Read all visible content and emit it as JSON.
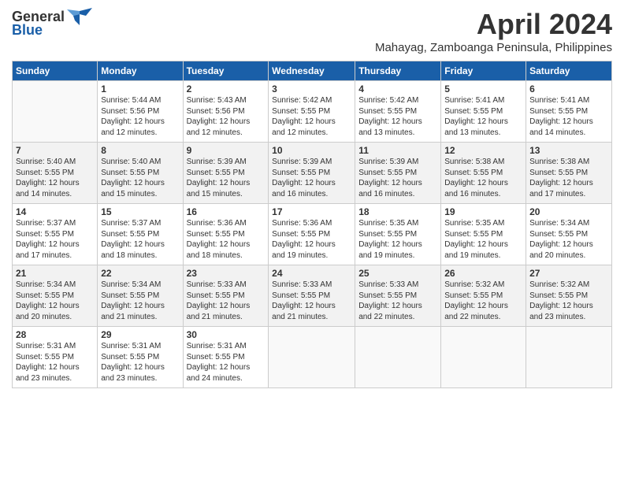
{
  "header": {
    "logo_general": "General",
    "logo_blue": "Blue",
    "main_title": "April 2024",
    "subtitle": "Mahayag, Zamboanga Peninsula, Philippines"
  },
  "weekdays": [
    "Sunday",
    "Monday",
    "Tuesday",
    "Wednesday",
    "Thursday",
    "Friday",
    "Saturday"
  ],
  "weeks": [
    [
      {
        "day": "",
        "info": ""
      },
      {
        "day": "1",
        "info": "Sunrise: 5:44 AM\nSunset: 5:56 PM\nDaylight: 12 hours\nand 12 minutes."
      },
      {
        "day": "2",
        "info": "Sunrise: 5:43 AM\nSunset: 5:56 PM\nDaylight: 12 hours\nand 12 minutes."
      },
      {
        "day": "3",
        "info": "Sunrise: 5:42 AM\nSunset: 5:55 PM\nDaylight: 12 hours\nand 12 minutes."
      },
      {
        "day": "4",
        "info": "Sunrise: 5:42 AM\nSunset: 5:55 PM\nDaylight: 12 hours\nand 13 minutes."
      },
      {
        "day": "5",
        "info": "Sunrise: 5:41 AM\nSunset: 5:55 PM\nDaylight: 12 hours\nand 13 minutes."
      },
      {
        "day": "6",
        "info": "Sunrise: 5:41 AM\nSunset: 5:55 PM\nDaylight: 12 hours\nand 14 minutes."
      }
    ],
    [
      {
        "day": "7",
        "info": "Sunrise: 5:40 AM\nSunset: 5:55 PM\nDaylight: 12 hours\nand 14 minutes."
      },
      {
        "day": "8",
        "info": "Sunrise: 5:40 AM\nSunset: 5:55 PM\nDaylight: 12 hours\nand 15 minutes."
      },
      {
        "day": "9",
        "info": "Sunrise: 5:39 AM\nSunset: 5:55 PM\nDaylight: 12 hours\nand 15 minutes."
      },
      {
        "day": "10",
        "info": "Sunrise: 5:39 AM\nSunset: 5:55 PM\nDaylight: 12 hours\nand 16 minutes."
      },
      {
        "day": "11",
        "info": "Sunrise: 5:39 AM\nSunset: 5:55 PM\nDaylight: 12 hours\nand 16 minutes."
      },
      {
        "day": "12",
        "info": "Sunrise: 5:38 AM\nSunset: 5:55 PM\nDaylight: 12 hours\nand 16 minutes."
      },
      {
        "day": "13",
        "info": "Sunrise: 5:38 AM\nSunset: 5:55 PM\nDaylight: 12 hours\nand 17 minutes."
      }
    ],
    [
      {
        "day": "14",
        "info": "Sunrise: 5:37 AM\nSunset: 5:55 PM\nDaylight: 12 hours\nand 17 minutes."
      },
      {
        "day": "15",
        "info": "Sunrise: 5:37 AM\nSunset: 5:55 PM\nDaylight: 12 hours\nand 18 minutes."
      },
      {
        "day": "16",
        "info": "Sunrise: 5:36 AM\nSunset: 5:55 PM\nDaylight: 12 hours\nand 18 minutes."
      },
      {
        "day": "17",
        "info": "Sunrise: 5:36 AM\nSunset: 5:55 PM\nDaylight: 12 hours\nand 19 minutes."
      },
      {
        "day": "18",
        "info": "Sunrise: 5:35 AM\nSunset: 5:55 PM\nDaylight: 12 hours\nand 19 minutes."
      },
      {
        "day": "19",
        "info": "Sunrise: 5:35 AM\nSunset: 5:55 PM\nDaylight: 12 hours\nand 19 minutes."
      },
      {
        "day": "20",
        "info": "Sunrise: 5:34 AM\nSunset: 5:55 PM\nDaylight: 12 hours\nand 20 minutes."
      }
    ],
    [
      {
        "day": "21",
        "info": "Sunrise: 5:34 AM\nSunset: 5:55 PM\nDaylight: 12 hours\nand 20 minutes."
      },
      {
        "day": "22",
        "info": "Sunrise: 5:34 AM\nSunset: 5:55 PM\nDaylight: 12 hours\nand 21 minutes."
      },
      {
        "day": "23",
        "info": "Sunrise: 5:33 AM\nSunset: 5:55 PM\nDaylight: 12 hours\nand 21 minutes."
      },
      {
        "day": "24",
        "info": "Sunrise: 5:33 AM\nSunset: 5:55 PM\nDaylight: 12 hours\nand 21 minutes."
      },
      {
        "day": "25",
        "info": "Sunrise: 5:33 AM\nSunset: 5:55 PM\nDaylight: 12 hours\nand 22 minutes."
      },
      {
        "day": "26",
        "info": "Sunrise: 5:32 AM\nSunset: 5:55 PM\nDaylight: 12 hours\nand 22 minutes."
      },
      {
        "day": "27",
        "info": "Sunrise: 5:32 AM\nSunset: 5:55 PM\nDaylight: 12 hours\nand 23 minutes."
      }
    ],
    [
      {
        "day": "28",
        "info": "Sunrise: 5:31 AM\nSunset: 5:55 PM\nDaylight: 12 hours\nand 23 minutes."
      },
      {
        "day": "29",
        "info": "Sunrise: 5:31 AM\nSunset: 5:55 PM\nDaylight: 12 hours\nand 23 minutes."
      },
      {
        "day": "30",
        "info": "Sunrise: 5:31 AM\nSunset: 5:55 PM\nDaylight: 12 hours\nand 24 minutes."
      },
      {
        "day": "",
        "info": ""
      },
      {
        "day": "",
        "info": ""
      },
      {
        "day": "",
        "info": ""
      },
      {
        "day": "",
        "info": ""
      }
    ]
  ]
}
